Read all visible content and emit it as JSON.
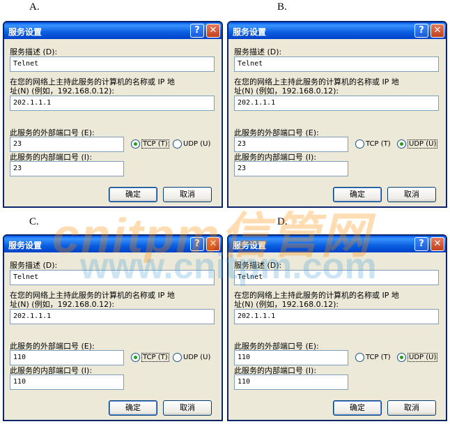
{
  "panels": [
    {
      "letter": "A.",
      "title": "服务设置",
      "help_glyph": "?",
      "close_glyph": "✕",
      "desc_label": "服务描述 (D):",
      "desc_value": "Telnet",
      "host_label_line1": "在您的网络上主持此服务的计算机的名称或 IP 地",
      "host_label_line2": "址(N) (例如，192.168.0.12):",
      "host_value": "202.1.1.1",
      "ext_port_label": "此服务的外部端口号 (E):",
      "ext_port_value": "23",
      "int_port_label": "此服务的内部端口号 (I):",
      "int_port_value": "23",
      "tcp_label": "TCP (T)",
      "udp_label": "UDP (U)",
      "protocol_selected": "TCP",
      "ok_label": "确定",
      "cancel_label": "取消"
    },
    {
      "letter": "B.",
      "title": "服务设置",
      "help_glyph": "?",
      "close_glyph": "✕",
      "desc_label": "服务描述 (D):",
      "desc_value": "Telnet",
      "host_label_line1": "在您的网络上主持此服务的计算机的名称或 IP 地",
      "host_label_line2": "址(N) (例如，192.168.0.12):",
      "host_value": "202.1.1.1",
      "ext_port_label": "此服务的外部端口号 (E):",
      "ext_port_value": "23",
      "int_port_label": "此服务的内部端口号 (I):",
      "int_port_value": "23",
      "tcp_label": "TCP (T)",
      "udp_label": "UDP (U)",
      "protocol_selected": "UDP",
      "ok_label": "确定",
      "cancel_label": "取消"
    },
    {
      "letter": "C.",
      "title": "服务设置",
      "help_glyph": "?",
      "close_glyph": "✕",
      "desc_label": "服务描述 (D):",
      "desc_value": "Telnet",
      "host_label_line1": "在您的网络上主持此服务的计算机的名称或 IP 地",
      "host_label_line2": "址(N) (例如，192.168.0.12):",
      "host_value": "202.1.1.1",
      "ext_port_label": "此服务的外部端口号 (E):",
      "ext_port_value": "110",
      "int_port_label": "此服务的内部端口号 (I):",
      "int_port_value": "110",
      "tcp_label": "TCP (T)",
      "udp_label": "UDP (U)",
      "protocol_selected": "TCP",
      "ok_label": "确定",
      "cancel_label": "取消"
    },
    {
      "letter": "D.",
      "title": "服务设置",
      "help_glyph": "?",
      "close_glyph": "✕",
      "desc_label": "服务描述 (D):",
      "desc_value": "Telnet",
      "host_label_line1": "在您的网络上主持此服务的计算机的名称或 IP 地",
      "host_label_line2": "址(N) (例如，192.168.0.12):",
      "host_value": "202.1.1.1",
      "ext_port_label": "此服务的外部端口号 (E):",
      "ext_port_value": "110",
      "int_port_label": "此服务的内部端口号 (I):",
      "int_port_value": "110",
      "tcp_label": "TCP (T)",
      "udp_label": "UDP (U)",
      "protocol_selected": "UDP",
      "ok_label": "确定",
      "cancel_label": "取消"
    }
  ],
  "watermark": {
    "line1": "cnitpm信管网",
    "line2": "www.cnitpm.com"
  }
}
